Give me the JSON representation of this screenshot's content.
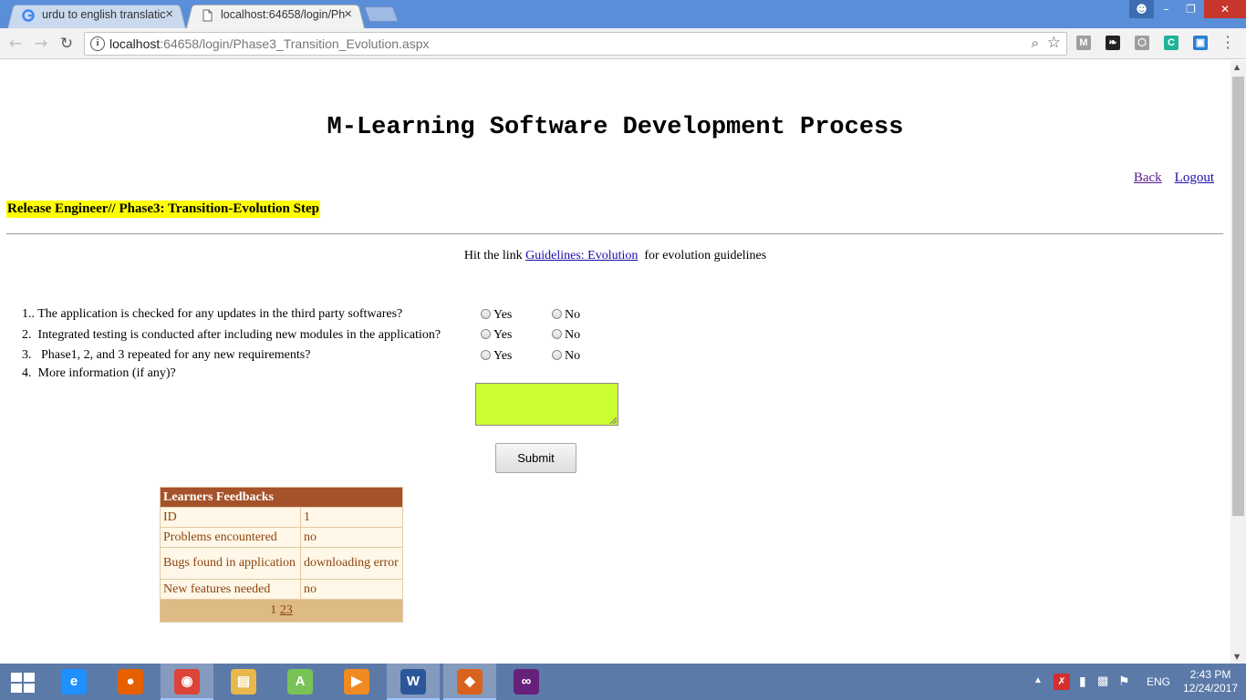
{
  "browser": {
    "tabs": [
      {
        "label": "urdu to english translatic",
        "active": false,
        "icon": "google-icon"
      },
      {
        "label": "localhost:64658/login/Ph",
        "active": true,
        "icon": "page-icon"
      }
    ],
    "url_host": "localhost",
    "url_rest": ":64658/login/Phase3_Transition_Evolution.aspx",
    "extensions": [
      {
        "name": "m-extension-icon",
        "glyph": "M",
        "color": "#9e9e9e"
      },
      {
        "name": "feather-extension-icon",
        "glyph": "❧",
        "color": "#222222"
      },
      {
        "name": "cube-extension-icon",
        "glyph": "⬡",
        "color": "#9e9e9e"
      },
      {
        "name": "c-extension-icon",
        "glyph": "C",
        "color": "#1fb39a"
      },
      {
        "name": "screen-extension-icon",
        "glyph": "▣",
        "color": "#2a7fd4"
      }
    ]
  },
  "page": {
    "title": "M-Learning Software Development Process",
    "links": {
      "back": "Back",
      "logout": "Logout"
    },
    "step_label": "Release Engineer// Phase3: Transition-Evolution Step",
    "hint_before": "Hit the link ",
    "hint_link": "Guidelines: Evolution",
    "hint_after": "  for evolution guidelines",
    "questions": [
      {
        "text": "1.. The application is checked for any updates in the third party softwares?",
        "yes": "Yes",
        "no": "No"
      },
      {
        "text": "2.  Integrated testing is conducted after including new modules in the application?",
        "yes": "Yes",
        "no": "No"
      },
      {
        "text": "3.   Phase1, 2, and 3 repeated for any new requirements?",
        "yes": "Yes",
        "no": "No"
      },
      {
        "text": "4.  More information (if any)?"
      }
    ],
    "more_info_value": "",
    "submit_label": "Submit",
    "feedback": {
      "header": "Learners Feedbacks",
      "rows": [
        {
          "label": "ID",
          "value": "1"
        },
        {
          "label": "Problems encountered",
          "value": "no"
        },
        {
          "label": "Bugs found in application",
          "value": "downloading error"
        },
        {
          "label": "New features needed",
          "value": "no"
        }
      ],
      "pager": {
        "current": "1",
        "pages": [
          "2",
          "3"
        ]
      }
    }
  },
  "taskbar": {
    "apps": [
      {
        "name": "internet-explorer-icon",
        "glyph": "e",
        "color": "#1e90ff",
        "active": false
      },
      {
        "name": "firefox-icon",
        "glyph": "●",
        "color": "#e66000",
        "active": false
      },
      {
        "name": "chrome-icon",
        "glyph": "◉",
        "color": "#db4437",
        "active": true
      },
      {
        "name": "file-explorer-icon",
        "glyph": "▤",
        "color": "#e8b84a",
        "active": false
      },
      {
        "name": "android-studio-icon",
        "glyph": "A",
        "color": "#78c257",
        "active": false
      },
      {
        "name": "media-player-icon",
        "glyph": "▶",
        "color": "#f08a24",
        "active": false
      },
      {
        "name": "word-icon",
        "glyph": "W",
        "color": "#2b579a",
        "active": true
      },
      {
        "name": "app-icon-orange",
        "glyph": "◆",
        "color": "#d9631e",
        "active": true
      },
      {
        "name": "visual-studio-icon",
        "glyph": "∞",
        "color": "#68217a",
        "active": false
      }
    ],
    "language": "ENG",
    "time": "2:43 PM",
    "date": "12/24/2017"
  }
}
